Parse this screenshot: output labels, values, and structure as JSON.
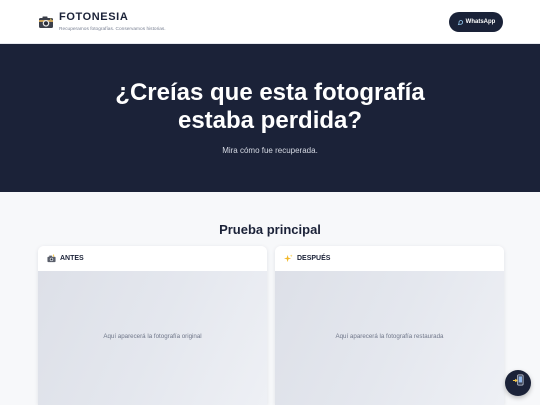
{
  "header": {
    "brand": "FOTONESIA",
    "tagline": "Recuperamos fotografías. Conservamos historias.",
    "logo_icon": "camera-icon",
    "cta_label": "WhatsApp",
    "cta_icon": "whatsapp-icon"
  },
  "hero": {
    "title_line1": "¿Creías que esta fotografía",
    "title_line2": "estaba perdida?",
    "subtitle": "Mira cómo fue recuperada."
  },
  "section": {
    "title": "Prueba principal",
    "before": {
      "label": "ANTES",
      "icon": "camera-flash-icon",
      "placeholder": "Aquí aparecerá la fotografía original"
    },
    "after": {
      "label": "DESPUÉS",
      "icon": "sparkles-icon",
      "placeholder": "Aquí aparecerá la fotografía restaurada"
    }
  },
  "floating_button": {
    "icon": "phone-message-icon"
  },
  "colors": {
    "navy": "#1b2238",
    "page_bg": "#f7f8fa",
    "placeholder_bg": "#e4e7ee"
  }
}
